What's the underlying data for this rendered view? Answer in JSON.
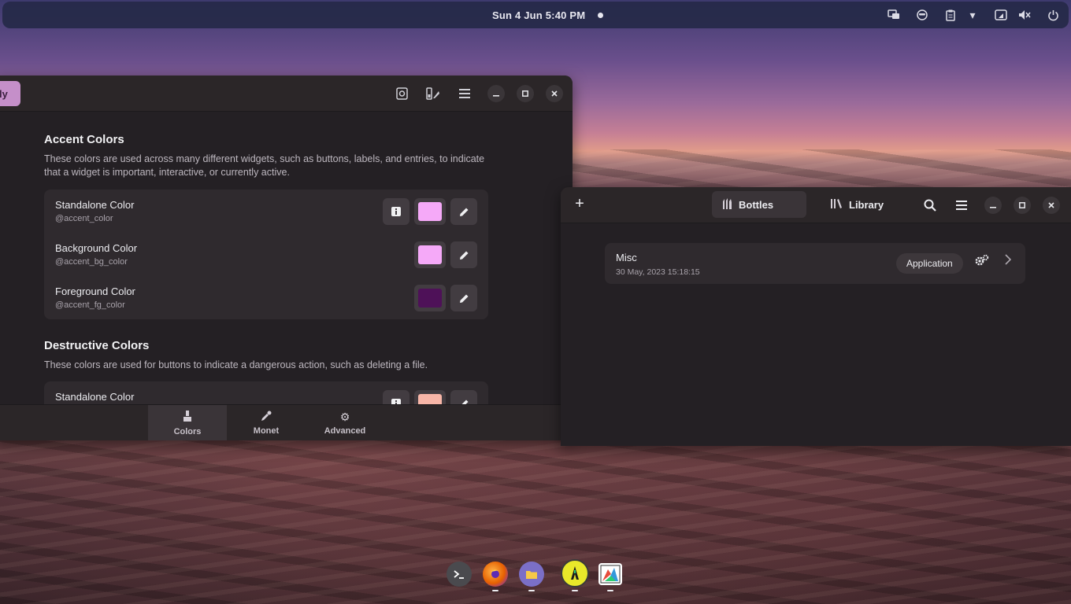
{
  "topbar": {
    "clock": "Sun 4 Jun   5:40 PM",
    "tray_icons": [
      "screens-icon",
      "smiley-icon",
      "clipboard-icon",
      "dropdown-icon",
      "network-icon",
      "volume-muted-icon",
      "power-icon"
    ]
  },
  "gradience": {
    "apply_label": "ly",
    "accent": {
      "title": "Accent Colors",
      "description": "These colors are used across many different widgets, such as buttons, labels, and entries, to indicate that a widget is important, interactive, or currently active.",
      "rows": [
        {
          "title": "Standalone Color",
          "variable": "@accent_color",
          "color": "#f5a9f8",
          "has_info": true
        },
        {
          "title": "Background Color",
          "variable": "@accent_bg_color",
          "color": "#f5a9f8",
          "has_info": false
        },
        {
          "title": "Foreground Color",
          "variable": "@accent_fg_color",
          "color": "#4e1158",
          "has_info": false
        }
      ]
    },
    "destructive": {
      "title": "Destructive Colors",
      "description": "These colors are used for buttons to indicate a dangerous action, such as deleting a file.",
      "rows": [
        {
          "title": "Standalone Color",
          "color": "#f8b6a8",
          "has_info": true
        }
      ]
    },
    "tabs": [
      {
        "label": "Colors",
        "active": true
      },
      {
        "label": "Monet",
        "active": false
      },
      {
        "label": "Advanced",
        "active": false
      }
    ]
  },
  "bottles": {
    "tabs": [
      {
        "label": "Bottles",
        "active": true
      },
      {
        "label": "Library",
        "active": false
      }
    ],
    "items": [
      {
        "name": "Misc",
        "date": "30 May, 2023 15:18:15",
        "badge": "Application"
      }
    ]
  },
  "dock": {
    "apps": [
      "terminal-icon",
      "firefox-icon",
      "files-icon",
      "bottles-icon",
      "gradience-icon"
    ]
  }
}
